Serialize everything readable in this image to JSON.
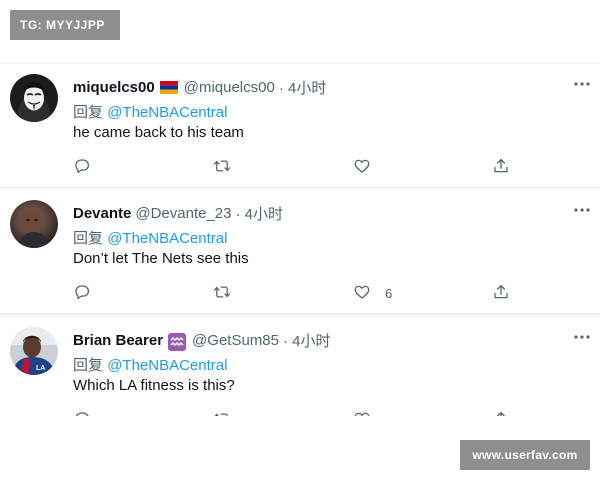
{
  "watermarks": {
    "top": "TG: MYYJJPP",
    "bottom": "www.userfav.com"
  },
  "reply_prefix": "回复",
  "tweets": [
    {
      "name": "miquelcs00",
      "flag": "armenia-flag",
      "handle": "@miquelcs00",
      "time": "· 4小时",
      "reply_to": "@TheNBACentral",
      "text": "he came back to his team",
      "likes": ""
    },
    {
      "name": "Devante",
      "handle": "@Devante_23",
      "time": "· 4小时",
      "reply_to": "@TheNBACentral",
      "text": "Don’t let The Nets see this",
      "likes": "6"
    },
    {
      "name": "Brian Bearer",
      "flag": "aquarius-emoji",
      "handle": "@GetSum85",
      "time": "· 4小时",
      "reply_to": "@TheNBACentral",
      "text": "Which LA fitness is this?",
      "likes": ""
    }
  ],
  "colors": {
    "link": "#1d9bf0",
    "muted": "#536471",
    "text": "#0f1419",
    "watermark_bg": "#8e8e8e"
  },
  "icons": [
    "more-icon",
    "reply-icon",
    "retweet-icon",
    "like-icon",
    "share-icon"
  ]
}
